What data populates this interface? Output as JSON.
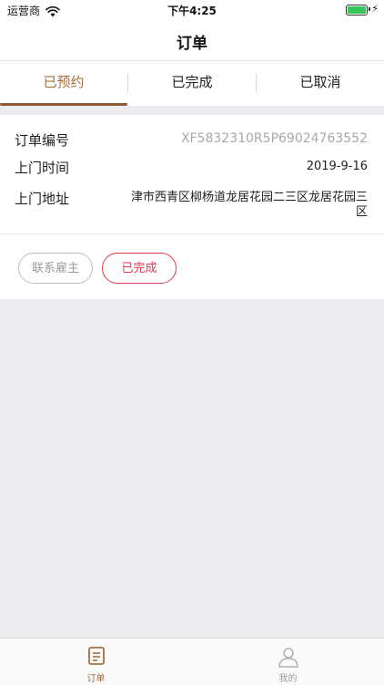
{
  "status_bar": {
    "carrier": "运营商",
    "time": "下午4:25"
  },
  "nav": {
    "title": "订单"
  },
  "tabs": [
    {
      "label": "已预约",
      "active": true
    },
    {
      "label": "已完成",
      "active": false
    },
    {
      "label": "已取消",
      "active": false
    }
  ],
  "order": {
    "number_label": "订单编号",
    "number_value": "XF5832310R5P69024763552",
    "time_label": "上门时间",
    "time_value": "2019-9-16",
    "address_label": "上门地址",
    "address_value": "津市西青区柳杨道龙居花园二三区龙居花园三区",
    "contact_button": "联系雇主",
    "done_button": "已完成"
  },
  "tabbar": [
    {
      "label": "订单",
      "icon": "order-icon",
      "active": true
    },
    {
      "label": "我的",
      "icon": "profile-icon",
      "active": false
    }
  ],
  "colors": {
    "accent_brown": "#8b5a33",
    "active_tab_text": "#a0703e",
    "done_red": "#e03a4c",
    "background_gray": "#ebebf0"
  }
}
